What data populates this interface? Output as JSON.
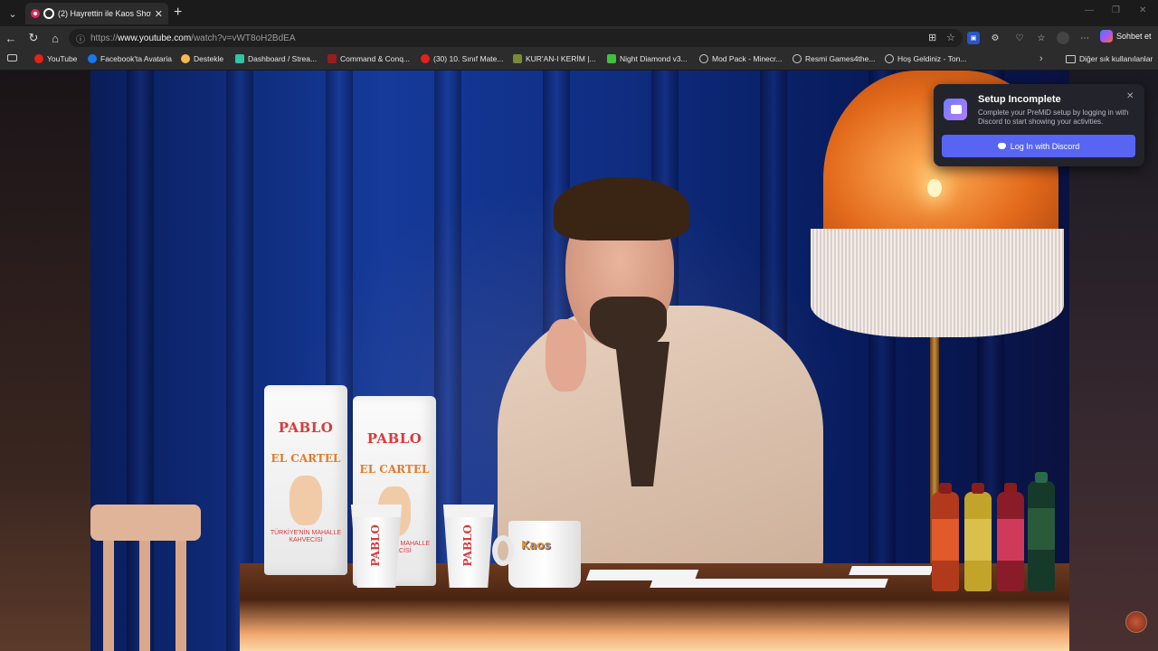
{
  "browser": {
    "tab": {
      "title": "(2) Hayrettin ile Kaos Show - ..."
    },
    "url_prefix": "https://",
    "url_host": "www.youtube.com",
    "url_path": "/watch?v=vWT8oH2BdEA",
    "copilot_label": "Sohbet et"
  },
  "bookmarks": {
    "items": [
      {
        "label": "YouTube",
        "icon": "youtube-icon",
        "color": "#e62117"
      },
      {
        "label": "Facebook'ta Avataria",
        "icon": "facebook-icon",
        "color": "#1877f2"
      },
      {
        "label": "Destekle",
        "icon": "patreon-icon",
        "color": "#f5b84a"
      },
      {
        "label": "Dashboard / Strea...",
        "icon": "streamlabs-icon",
        "color": "#31c3a2"
      },
      {
        "label": "Command & Conq...",
        "icon": "cnc-icon",
        "color": "#9b1c1c"
      },
      {
        "label": "(30) 10. Sınıf Mate...",
        "icon": "youtube-icon",
        "color": "#e62117"
      },
      {
        "label": "KUR'AN-I KERİM |...",
        "icon": "quran-icon",
        "color": "#7a8a3a"
      },
      {
        "label": "Night Diamond v3...",
        "icon": "curseforge-icon",
        "color": "#3ec23e"
      },
      {
        "label": "Mod Pack - Minecr...",
        "icon": "globe-icon",
        "color": "#cccccc"
      },
      {
        "label": "Resmi Games4the...",
        "icon": "globe-icon",
        "color": "#cccccc"
      },
      {
        "label": "Hoş Geldiniz - Ton...",
        "icon": "globe-icon",
        "color": "#cccccc"
      }
    ],
    "other_label": "Diğer sık kullanılanlar"
  },
  "video": {
    "bag_brand": "PABLO",
    "bag_sub": "EL CARTEL",
    "bag_tag": "TÜRKİYE'NİN MAHALLE KAHVECİSİ",
    "cup_text": "PABLO",
    "mug_logo": "Kaos"
  },
  "popup": {
    "title": "Setup Incomplete",
    "description": "Complete your PreMiD setup by logging in with Discord to start showing your activities.",
    "button_label": "Log In with Discord",
    "accent": "#5865f2"
  }
}
